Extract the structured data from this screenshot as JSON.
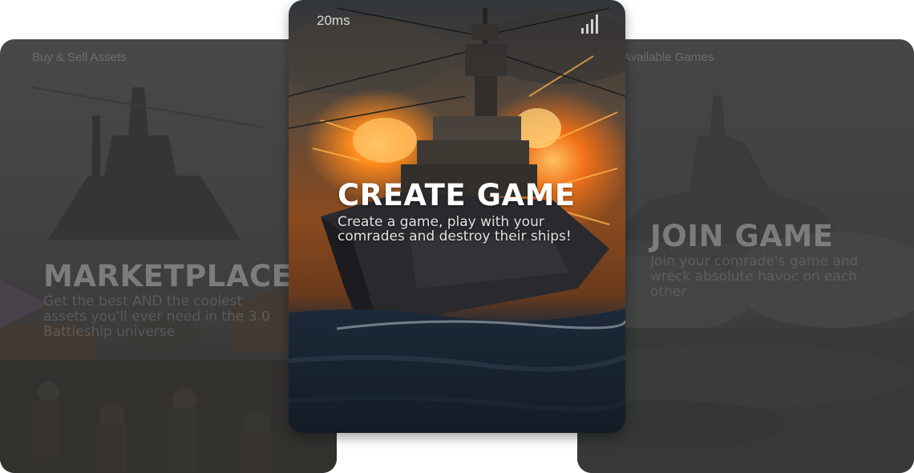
{
  "cards": {
    "marketplace": {
      "top_text": "Buy & Sell Assets",
      "title": "MARKETPLACE",
      "description": "Get the best AND the coolest assets you'll ever need in the 3.0 Battleship universe"
    },
    "create_game": {
      "latency": "20ms",
      "signal_icon": "signal-bars-icon",
      "title": "CREATE GAME",
      "description": "Create a game, play with your comrades and destroy their ships!"
    },
    "join_game": {
      "top_text": "Available Games",
      "title": "JOIN GAME",
      "description": "Join your comrade's game and wreck absolute havoc on each other"
    }
  },
  "colors": {
    "page_background": "#ffffff",
    "side_overlay": "#2d2d2d",
    "fire": "#ff8a1c",
    "sea": "#1d2a3a"
  }
}
